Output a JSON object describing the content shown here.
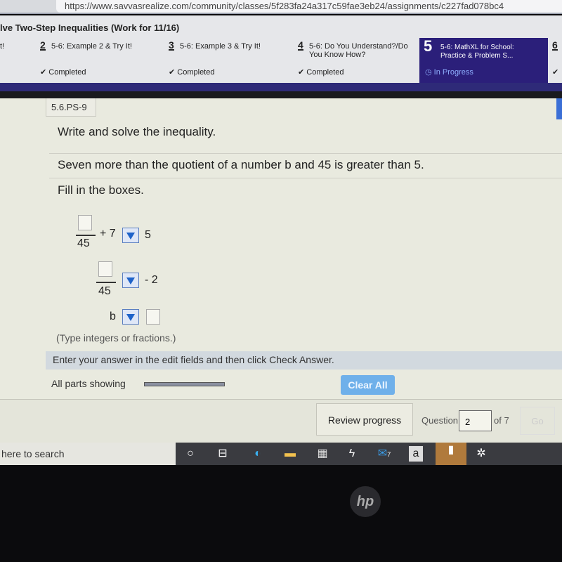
{
  "browser": {
    "url": "https://www.savvasrealize.com/community/classes/5f283fa24a317c59fae3eb24/assignments/c227fad078bc4"
  },
  "header": {
    "title": "lve Two-Step Inequalities (Work for 11/16)",
    "tabs": [
      {
        "num": "",
        "label": "t!",
        "status": ""
      },
      {
        "num": "2",
        "label": "5-6: Example 2 & Try It!",
        "status": "Completed"
      },
      {
        "num": "3",
        "label": "5-6: Example 3 & Try It!",
        "status": "Completed"
      },
      {
        "num": "4",
        "label": "5-6: Do You Understand?/Do You Know How?",
        "status": "Completed"
      },
      {
        "num": "5",
        "label": "5-6: MathXL for School: Practice & Problem S...",
        "status": "In Progress"
      },
      {
        "num": "6",
        "label": "",
        "status": ""
      }
    ]
  },
  "question": {
    "id": "5.6.PS-9",
    "prompt": "Write and solve the inequality.",
    "statement": "Seven more than the quotient of a number b and 45 is greater than 5.",
    "fill": "Fill in the boxes.",
    "math": {
      "denom1": "45",
      "plus7": "+ 7",
      "rhs1": "5",
      "minus2": "- 2",
      "denom2": "45",
      "var": "b"
    },
    "hint": "(Type integers or fractions.)"
  },
  "instruction": "Enter your answer in the edit fields and then click Check Answer.",
  "parts_label": "All parts showing",
  "clear_all": "Clear All",
  "footer": {
    "review": "Review progress",
    "question_label": "Question",
    "question_value": "2",
    "of": "of 7",
    "go": "Go"
  },
  "taskbar": {
    "search": "here to search",
    "mail_badge": "7"
  },
  "colors": {
    "active_tab": "#2b1f7a",
    "clear_button": "#6fb0ea",
    "dropdown_arrow": "#1f63c9"
  }
}
